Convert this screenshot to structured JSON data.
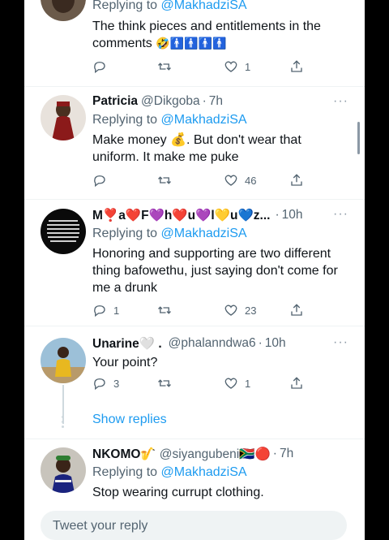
{
  "tweets": [
    {
      "id": "t0",
      "replying_prefix": "Replying to ",
      "replying_to": "@MakhadziSA",
      "text": "The think pieces and entitlements in the comments",
      "text_emoji": "🤣🚹🚹🚹🚹",
      "reply_count": "",
      "like_count": "1"
    },
    {
      "id": "t1",
      "name": "Patricia",
      "handle": "@Dikgoba",
      "time": "7h",
      "replying_prefix": "Replying to ",
      "replying_to": "@MakhadziSA",
      "text_line1": "Make money 💰.  But don't wear that",
      "text_line2": "uniform.  It make me puke",
      "reply_count": "",
      "like_count": "46"
    },
    {
      "id": "t2",
      "name": "M❣️a❤️F💜h❤️u💜l💛u💙z...",
      "time": "10h",
      "replying_prefix": "Replying to ",
      "replying_to": "@MakhadziSA",
      "text_line1": "Honoring and supporting are two different",
      "text_line2": "thing bafowethu, just saying don't come for",
      "text_line3": "me a drunk",
      "reply_count": "1",
      "like_count": "23"
    },
    {
      "id": "t3",
      "name": "Unarine🤍 .",
      "handle": "@phalanndwa6",
      "time": "10h",
      "text": "Your point?",
      "reply_count": "3",
      "like_count": "1"
    },
    {
      "id": "t4",
      "name": "NKOMO🎷",
      "handle": "@siyangubeni🇿🇦🔴",
      "time": "7h",
      "replying_prefix": "Replying to ",
      "replying_to": "@MakhadziSA",
      "text": "Stop wearing currupt clothing."
    }
  ],
  "show_replies": "Show replies",
  "reply_box": {
    "placeholder": "Tweet your reply"
  },
  "more_label": "···",
  "dot": "·",
  "colors": {
    "accent": "#1d9bf0",
    "secondary_text": "#536471",
    "divider": "#eff3f4"
  }
}
